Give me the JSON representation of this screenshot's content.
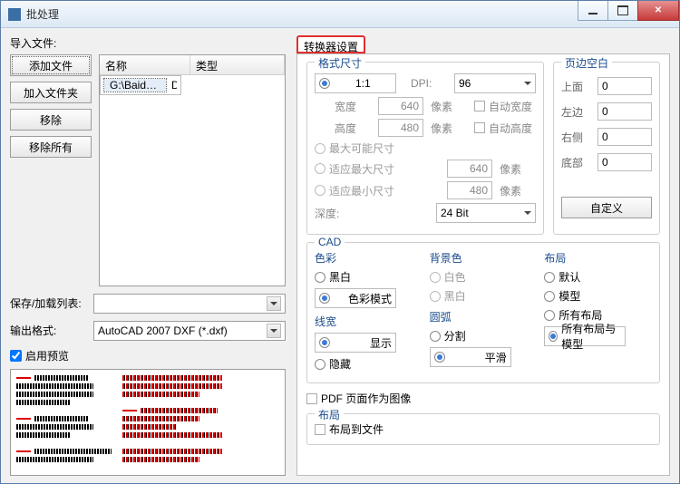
{
  "window": {
    "title": "批处理"
  },
  "left": {
    "import_label": "导入文件:",
    "buttons": {
      "add_file": "添加文件",
      "add_folder": "加入文件夹",
      "remove": "移除",
      "remove_all": "移除所有"
    },
    "list": {
      "col_name": "名称",
      "col_type": "类型",
      "rows": [
        {
          "name": "G:\\BaiduNet...",
          "type": "DWG"
        }
      ]
    },
    "save_list_label": "保存/加载列表:",
    "output_format_label": "输出格式:",
    "output_format_value": "AutoCAD 2007 DXF (*.dxf)",
    "enable_preview": "启用预览"
  },
  "tabs": {
    "converter_settings": "转换器设置"
  },
  "format_size": {
    "legend": "格式尺寸",
    "ratio_11": "1:1",
    "dpi_label": "DPI:",
    "dpi_value": "96",
    "width_label": "宽度",
    "width_value": "640",
    "px1": "像素",
    "auto_width": "自动宽度",
    "height_label": "高度",
    "height_value": "480",
    "px2": "像素",
    "auto_height": "自动高度",
    "max_possible": "最大可能尺寸",
    "fit_max": "适应最大尺寸",
    "fit_max_val": "640",
    "px3": "像素",
    "fit_min": "适应最小尺寸",
    "fit_min_val": "480",
    "px4": "像素",
    "depth_label": "深度:",
    "depth_value": "24 Bit"
  },
  "margins": {
    "legend": "页边空白",
    "top": "上面",
    "left": "左边",
    "right": "右侧",
    "bottom": "底部",
    "zero": "0",
    "custom_btn": "自定义"
  },
  "cad": {
    "legend": "CAD",
    "color_legend": "色彩",
    "bw": "黑白",
    "color_mode": "色彩模式",
    "bg_legend": "背景色",
    "white": "白色",
    "black": "黑白",
    "line_legend": "线宽",
    "show": "显示",
    "hide": "隐藏",
    "arc_legend": "圆弧",
    "split": "分割",
    "smooth": "平滑",
    "layout_legend": "布局",
    "default": "默认",
    "model": "模型",
    "all_layout": "所有布局",
    "all_layout_model": "所有布局与模型"
  },
  "pdf_as_image": "PDF 页面作为图像",
  "layout2": {
    "legend": "布局",
    "to_file": "布局到文件"
  }
}
